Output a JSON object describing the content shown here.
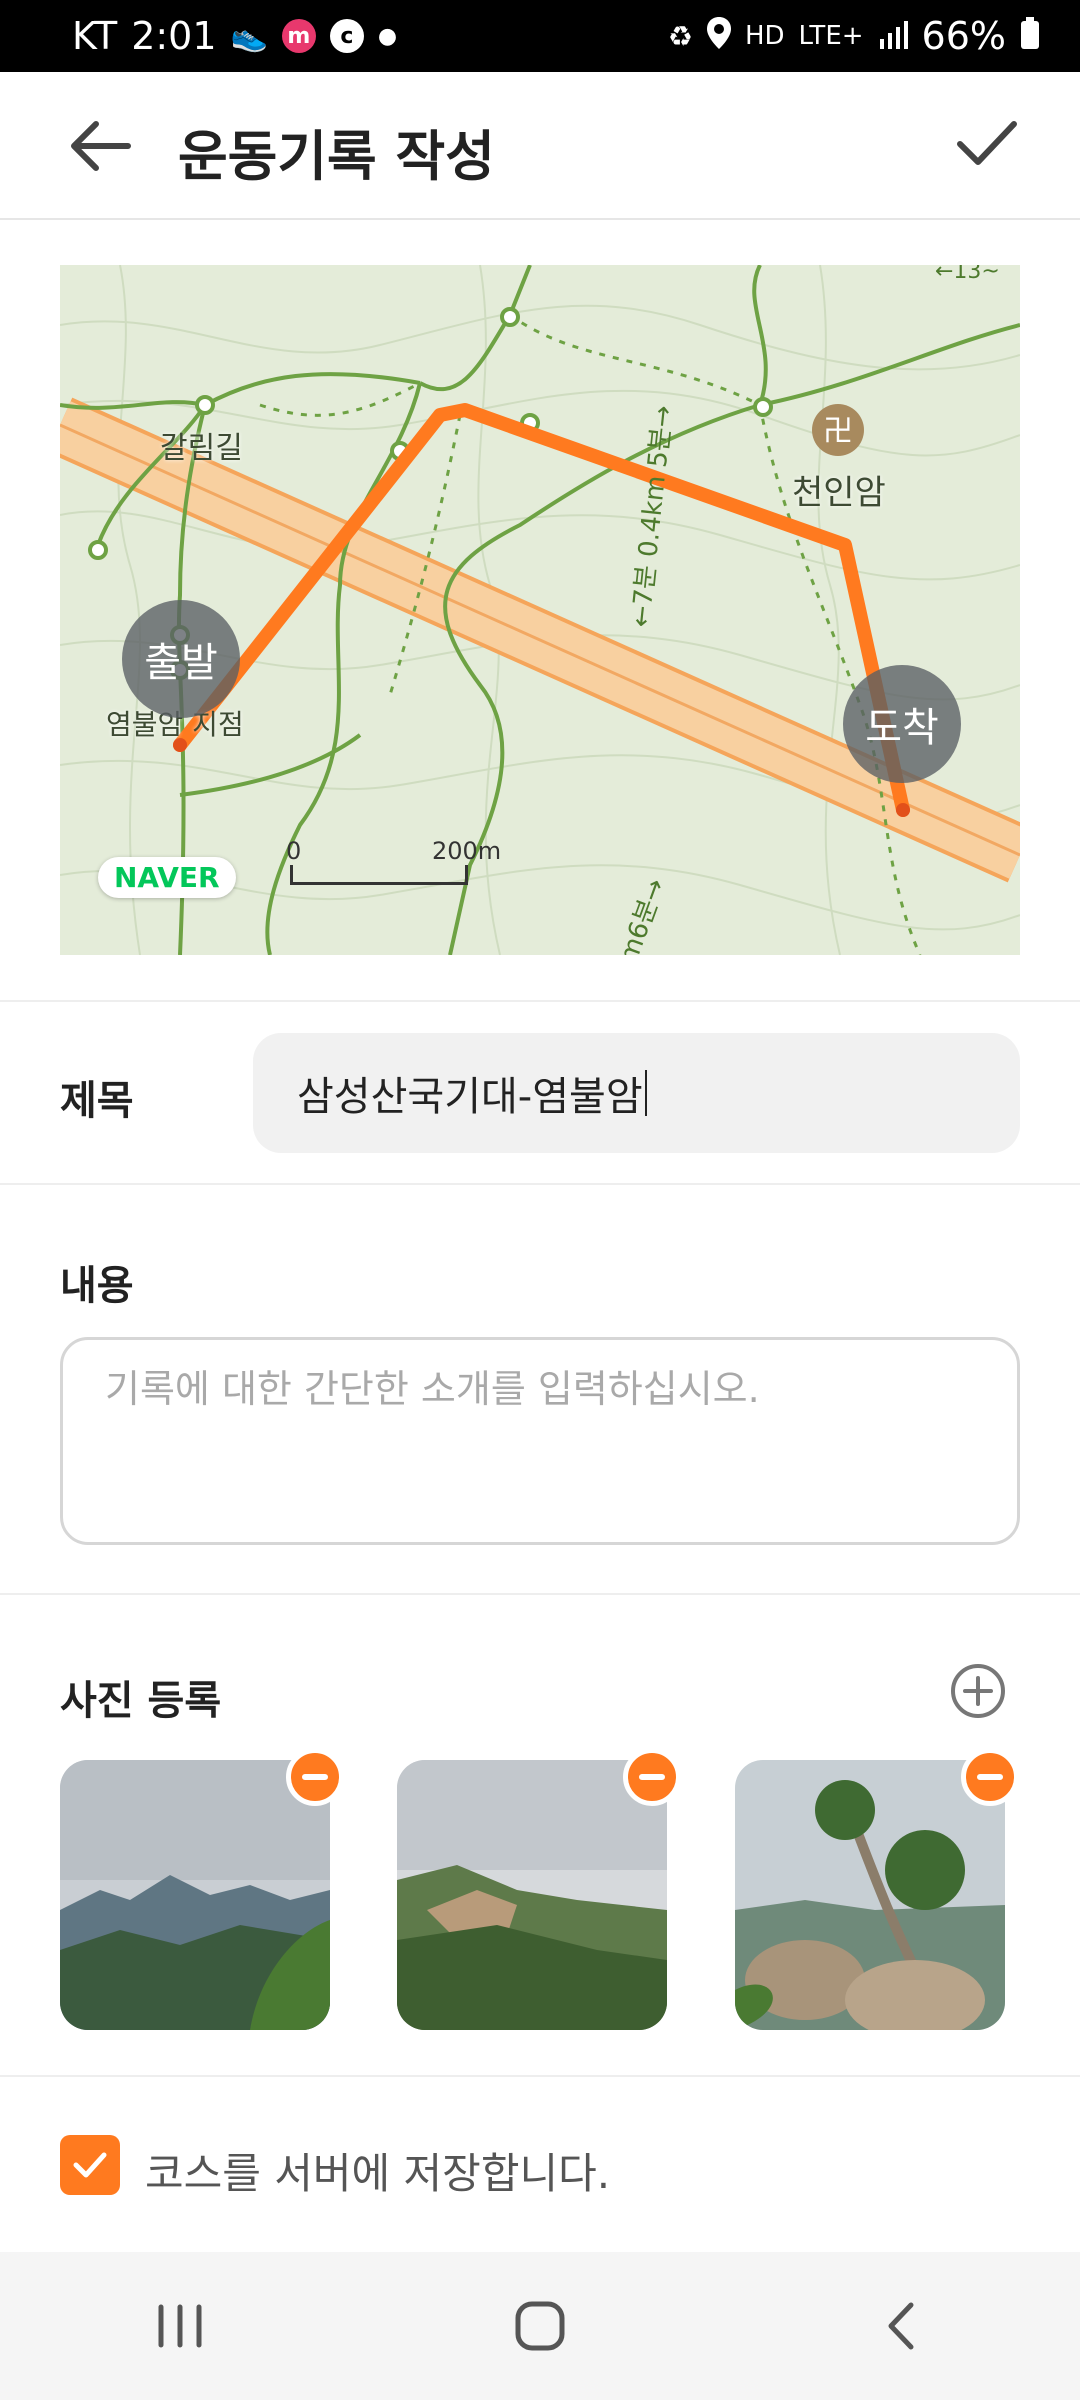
{
  "status_bar": {
    "carrier": "KT",
    "time": "2:01",
    "network_hd": "HD",
    "network": "LTE+",
    "battery": "66%",
    "icons": [
      "shoe-icon",
      "m-app-icon",
      "c-app-icon",
      "dot-icon",
      "battery-saver-icon",
      "location-icon",
      "signal-icon",
      "battery-icon"
    ]
  },
  "header": {
    "title": "운동기록 작성",
    "back_icon": "arrow-left-icon",
    "confirm_icon": "check-icon"
  },
  "map": {
    "start_label": "출발",
    "end_label": "도착",
    "place_labels": [
      "갈림길",
      "천인암",
      "염불암 지점"
    ],
    "trail_label_1": "←7분 0.4km 5분→",
    "trail_label_2": "m6분→",
    "trail_label_3": "←13~",
    "brand": "NAVER",
    "scale_start": "0",
    "scale_end": "200m",
    "colors": {
      "route": "#ff7a1f",
      "road": "#f6c88f",
      "trail": "#6ea244",
      "land": "#e4ecd9"
    }
  },
  "form": {
    "title_label": "제목",
    "title_value": "삼성산국기대-염불암",
    "content_label": "내용",
    "content_placeholder": "기록에 대한 간단한 소개를 입력하십시오.",
    "photos_label": "사진 등록",
    "photo_count": 3,
    "save_course_label": "코스를 서버에 저장합니다.",
    "save_course_checked": true
  },
  "accent_color": "#ff7a1f",
  "nav_bar": {
    "icons": [
      "recent-apps-icon",
      "home-icon",
      "back-icon"
    ]
  }
}
